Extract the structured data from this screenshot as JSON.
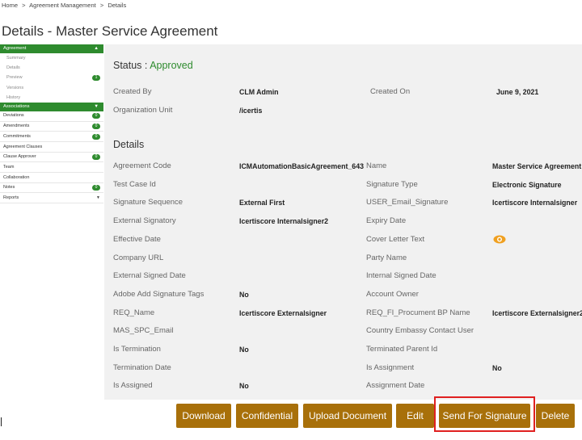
{
  "breadcrumb": {
    "home": "Home",
    "separator": ">",
    "mid": "Agreement Management",
    "current": "Details"
  },
  "page_title": "Details - Master Service Agreement",
  "sidebar": {
    "agreement_header": "Agreement",
    "agreement_items": [
      {
        "label": "Summary"
      },
      {
        "label": "Details"
      },
      {
        "label": "Preview",
        "badge": "1"
      },
      {
        "label": "Versions"
      },
      {
        "label": "History"
      }
    ],
    "associations_header": "Associations",
    "association_items": [
      {
        "label": "Deviations",
        "badge": "0"
      },
      {
        "label": "Amendments",
        "badge": "0"
      },
      {
        "label": "Commitments",
        "badge": "0"
      },
      {
        "label": "Agreement Clauses"
      },
      {
        "label": "Clause Approver",
        "badge": "0"
      },
      {
        "label": "Team"
      },
      {
        "label": "Collaboration"
      },
      {
        "label": "Notes",
        "badge": "0"
      },
      {
        "label": "Reports",
        "caret": "▼"
      }
    ],
    "caret_up": "▲",
    "caret_down": "▼"
  },
  "status": {
    "label": "Status :",
    "value": "Approved"
  },
  "meta": {
    "created_by_label": "Created By",
    "created_by_value": "CLM Admin",
    "created_on_label": "Created On",
    "created_on_value": "June 9, 2021",
    "org_unit_label": "Organization Unit",
    "org_unit_value": "/icertis"
  },
  "details_title": "Details",
  "details_left": [
    {
      "label": "Agreement Code",
      "value": "ICMAutomationBasicAgreement_643"
    },
    {
      "label": "Test Case Id",
      "value": ""
    },
    {
      "label": "Signature Sequence",
      "value": "External First"
    },
    {
      "label": "External Signatory",
      "value": "Icertiscore Internalsigner2"
    },
    {
      "label": "Effective Date",
      "value": ""
    },
    {
      "label": "Company URL",
      "value": ""
    },
    {
      "label": "External Signed Date",
      "value": ""
    },
    {
      "label": "Adobe Add Signature Tags",
      "value": "No"
    },
    {
      "label": "REQ_Name",
      "value": "Icertiscore Externalsigner"
    },
    {
      "label": "MAS_SPC_Email",
      "value": ""
    },
    {
      "label": "Is Termination",
      "value": "No"
    },
    {
      "label": "Termination Date",
      "value": ""
    },
    {
      "label": "Is Assigned",
      "value": "No"
    }
  ],
  "details_right": [
    {
      "label": "Name",
      "value": "Master Service Agreement"
    },
    {
      "label": "Signature Type",
      "value": "Electronic Signature"
    },
    {
      "label": "USER_Email_Signature",
      "value": "Icertiscore Internalsigner"
    },
    {
      "label": "Expiry Date",
      "value": ""
    },
    {
      "label": "Cover Letter Text",
      "value": ""
    },
    {
      "label": "Party Name",
      "value": ""
    },
    {
      "label": "Internal Signed Date",
      "value": ""
    },
    {
      "label": "Account Owner",
      "value": ""
    },
    {
      "label": "REQ_FI_Procument BP Name",
      "value": "Icertiscore Externalsigner2"
    },
    {
      "label": "Country Embassy Contact User",
      "value": ""
    },
    {
      "label": "Terminated Parent Id",
      "value": ""
    },
    {
      "label": "Is Assignment",
      "value": "No"
    },
    {
      "label": "Assignment Date",
      "value": ""
    }
  ],
  "cover_letter_icon": "eye-icon",
  "buttons": {
    "download": "Download",
    "confidential": "Confidential",
    "upload": "Upload Document",
    "edit": "Edit",
    "send": "Send For Signature",
    "delete": "Delete"
  },
  "colors": {
    "accent": "#2e8b2e",
    "button": "#a8700a",
    "highlight": "#e02020",
    "panel": "#f1f1f1"
  }
}
